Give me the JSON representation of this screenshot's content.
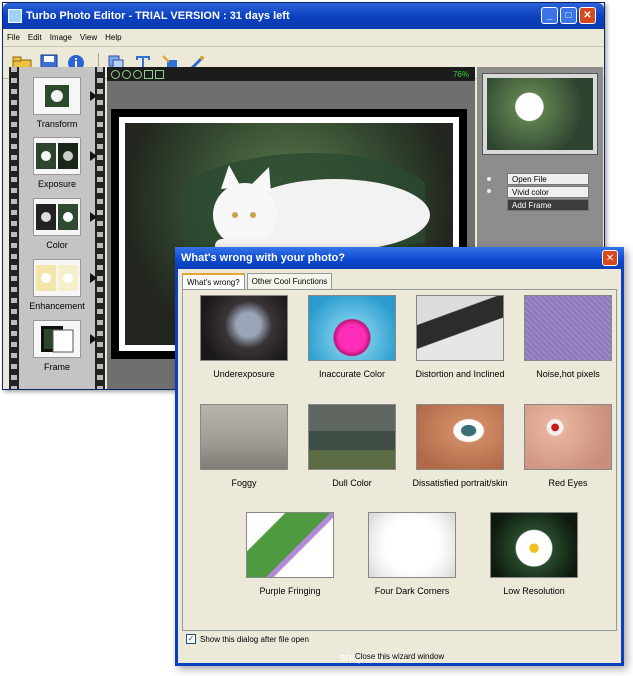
{
  "main_window": {
    "title": "Turbo Photo Editor - TRIAL VERSION : 31 days left",
    "menu": [
      "File",
      "Edit",
      "Image",
      "View",
      "Help"
    ],
    "toolbar_icons": [
      "open-folder-icon",
      "save-icon",
      "info-icon",
      "batch-icon",
      "text-icon",
      "resize-icon",
      "brush-icon"
    ]
  },
  "filmstrip": {
    "items": [
      {
        "label": "Transform"
      },
      {
        "label": "Exposure"
      },
      {
        "label": "Color"
      },
      {
        "label": "Enhancement"
      },
      {
        "label": "Frame"
      }
    ]
  },
  "canvas": {
    "zoom": "76%"
  },
  "history": {
    "items": [
      "Open File",
      "Vivid color",
      "Add Frame"
    ]
  },
  "dialog": {
    "title": "What's wrong with your photo?",
    "tabs": [
      "What's wrong?",
      "Other Cool Functions"
    ],
    "cards": [
      {
        "label": "Underexposure"
      },
      {
        "label": "Inaccurate Color"
      },
      {
        "label": "Distortion and Inclined"
      },
      {
        "label": "Noise,hot pixels"
      },
      {
        "label": "Foggy"
      },
      {
        "label": "Dull Color"
      },
      {
        "label": "Dissatisfied portrait/skin"
      },
      {
        "label": "Red Eyes"
      },
      {
        "label": "Purple Fringing"
      },
      {
        "label": "Four Dark Corners"
      },
      {
        "label": "Low Resolution"
      }
    ],
    "watermark": "snapfiles.com",
    "checkbox_label": "Show this dialog after file open",
    "close_link": "Close this wizard window"
  }
}
